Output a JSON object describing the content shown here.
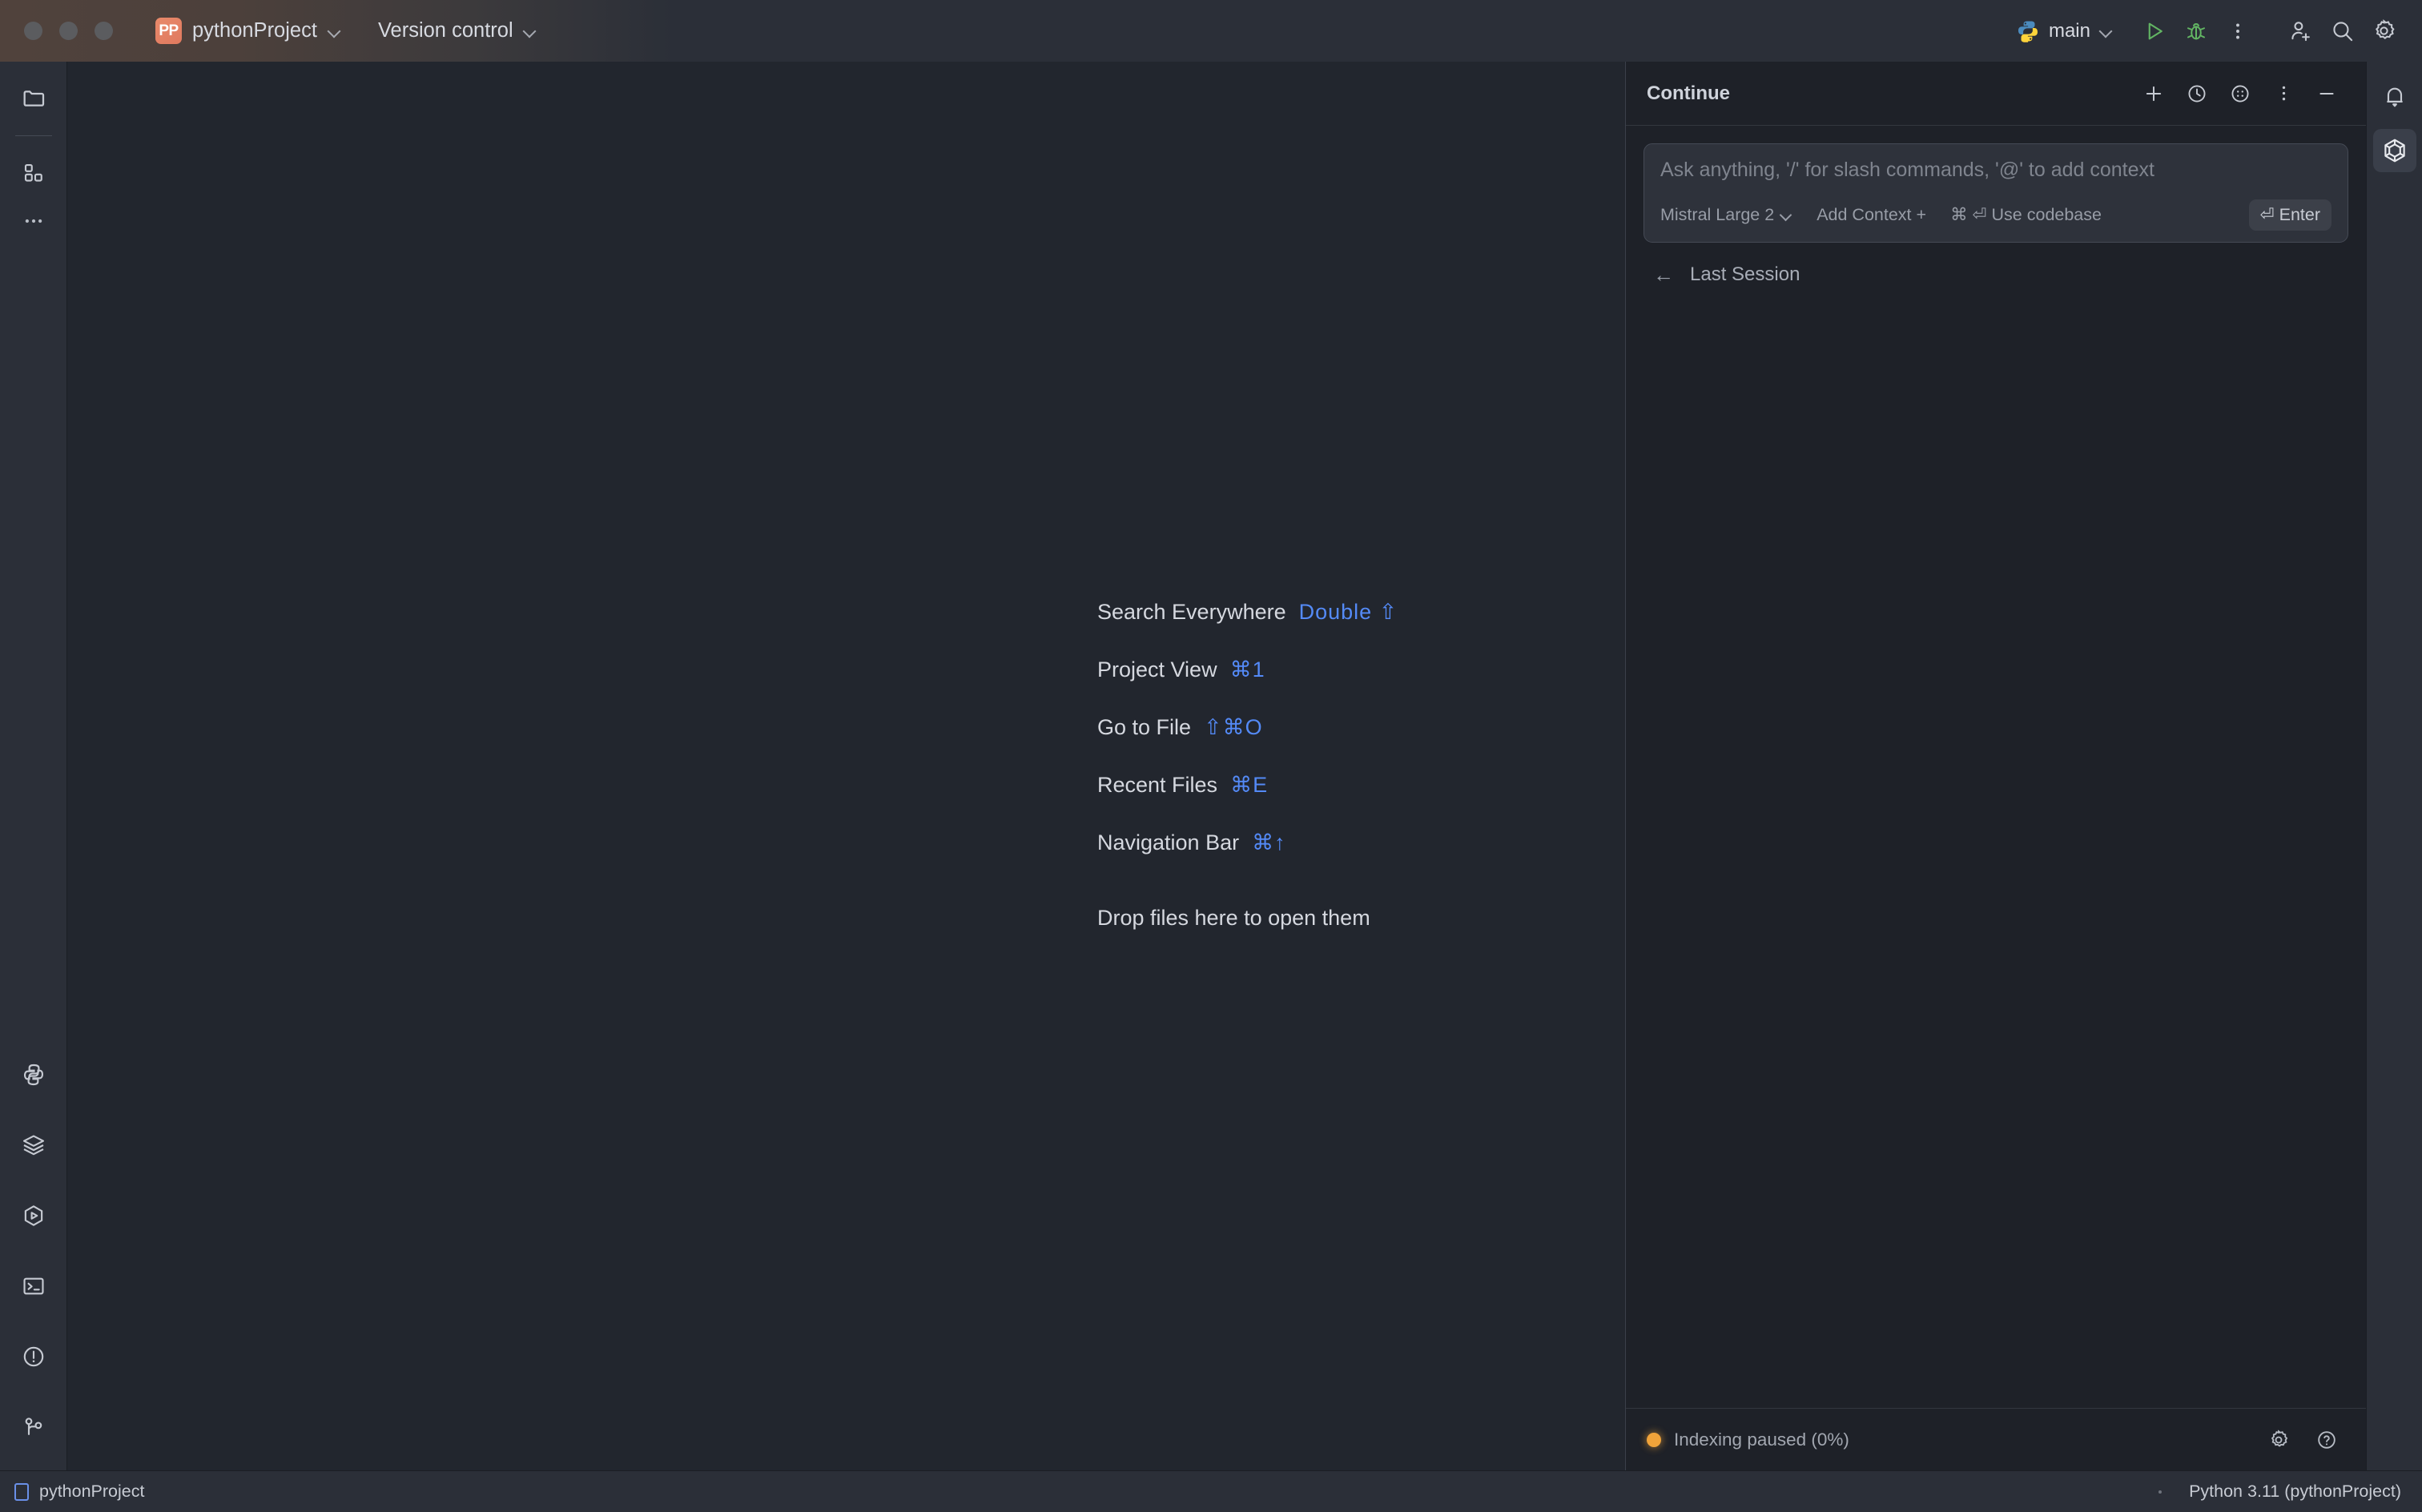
{
  "titlebar": {
    "project_badge": "PP",
    "project_name": "pythonProject",
    "version_control": "Version control",
    "run_config": "main",
    "icons": {
      "python": "python-logo-icon",
      "run": "run-icon",
      "debug": "debug-icon",
      "more": "more-vertical-icon",
      "add_user": "add-user-icon",
      "search": "search-icon",
      "settings": "gear-icon"
    }
  },
  "left_strip": {
    "items": [
      {
        "name": "project-tool-window",
        "icon": "folder-icon"
      },
      {
        "name": "structure-tool-window",
        "icon": "blocks-icon"
      },
      {
        "name": "more-tool-windows",
        "icon": "more-horizontal-icon"
      }
    ],
    "bottom_items": [
      {
        "name": "python-console",
        "icon": "python-console-icon"
      },
      {
        "name": "database",
        "icon": "layers-icon"
      },
      {
        "name": "run-tool-window",
        "icon": "hexagon-play-icon"
      },
      {
        "name": "terminal",
        "icon": "terminal-icon"
      },
      {
        "name": "problems",
        "icon": "warning-circle-icon"
      },
      {
        "name": "version-control-tool-window",
        "icon": "git-branch-icon"
      }
    ]
  },
  "editor": {
    "hints": [
      {
        "label": "Search Everywhere",
        "shortcut": "Double ⇧"
      },
      {
        "label": "Project View",
        "shortcut": "⌘1"
      },
      {
        "label": "Go to File",
        "shortcut": "⇧⌘O"
      },
      {
        "label": "Recent Files",
        "shortcut": "⌘E"
      },
      {
        "label": "Navigation Bar",
        "shortcut": "⌘↑"
      }
    ],
    "drop_hint": "Drop files here to open them"
  },
  "continue_panel": {
    "title": "Continue",
    "header_icons": [
      {
        "name": "new-session-button",
        "icon": "plus-icon"
      },
      {
        "name": "history-button",
        "icon": "clock-icon"
      },
      {
        "name": "apps-button",
        "icon": "circle-dots-icon"
      },
      {
        "name": "options-button",
        "icon": "more-vertical-icon"
      },
      {
        "name": "minimize-button",
        "icon": "minus-icon"
      }
    ],
    "composer": {
      "placeholder": "Ask anything, '/' for slash commands, '@' to add context",
      "model": "Mistral Large 2",
      "add_context": "Add Context +",
      "use_codebase": "⌘ ⏎ Use codebase",
      "enter": "⏎ Enter"
    },
    "last_session": {
      "arrow": "←",
      "label": "Last Session"
    },
    "footer": {
      "status": "Indexing paused (0%)",
      "status_color": "#f0a33a",
      "icons": [
        {
          "name": "continue-settings-button",
          "icon": "gear-icon"
        },
        {
          "name": "continue-help-button",
          "icon": "help-circle-icon"
        }
      ]
    }
  },
  "right_strip": {
    "items": [
      {
        "name": "notifications-button",
        "icon": "bell-icon",
        "active": false
      },
      {
        "name": "continue-tool-window-button",
        "icon": "continue-hexagon-icon",
        "active": true
      }
    ]
  },
  "statusbar": {
    "project": "pythonProject",
    "interpreter": "Python 3.11 (pythonProject)"
  },
  "colors": {
    "accent_blue": "#548af7",
    "project_badge": "#e07a5f",
    "status_amber": "#f0a33a",
    "panel_bg": "#1e2128",
    "editor_bg": "#22262e",
    "chrome_bg": "#2b2f38"
  }
}
